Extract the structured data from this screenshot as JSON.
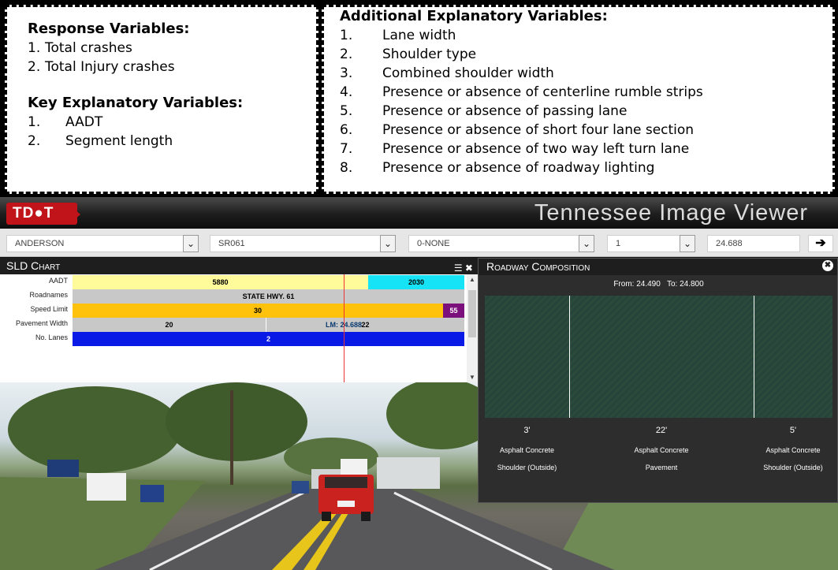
{
  "response_block": {
    "title": "Response Variables:",
    "items": [
      {
        "num": "1.",
        "text": "Total crashes"
      },
      {
        "num": "2.",
        "text": "Total Injury crashes"
      }
    ]
  },
  "key_block": {
    "title": "Key Explanatory Variables:",
    "items": [
      {
        "num": "1.",
        "text": "AADT"
      },
      {
        "num": "2.",
        "text": "Segment length"
      }
    ]
  },
  "additional_block": {
    "title": "Additional Explanatory Variables:",
    "items": [
      {
        "num": "1.",
        "text": "Lane width"
      },
      {
        "num": "2.",
        "text": "Shoulder type"
      },
      {
        "num": "3.",
        "text": "Combined shoulder width"
      },
      {
        "num": "4.",
        "text": "Presence or absence of centerline rumble strips"
      },
      {
        "num": "5.",
        "text": "Presence or absence of passing lane"
      },
      {
        "num": "6.",
        "text": "Presence or absence of short four lane section"
      },
      {
        "num": "7.",
        "text": "Presence or absence of two way left turn lane"
      },
      {
        "num": "8.",
        "text": "Presence or absence of roadway lighting"
      }
    ]
  },
  "app": {
    "logo": "TD●T",
    "title": "Tennessee Image Viewer",
    "selectors": {
      "county": "ANDERSON",
      "route": "SR061",
      "special_case": "0-NONE",
      "direction": "1",
      "log_mile": "24.688",
      "go_icon": "➔",
      "dropdown_icon": "⌄"
    },
    "sld": {
      "title": "SLD Chart",
      "row_labels": [
        "AADT",
        "Roadnames",
        "Speed Limit",
        "Pavement Width",
        "No. Lanes"
      ],
      "aadt_left": "5880",
      "aadt_right": "2030",
      "roadname": "STATE HWY. 61",
      "speed_left": "30",
      "speed_right": "55",
      "pavement_left": "20",
      "pavement_right": "22",
      "log_mile_marker": "LM: 24.688",
      "lanes": "2",
      "colors": {
        "aadt_left": "#fffa9a",
        "aadt_right": "#16e3f5",
        "roadname": "#c8c8c8",
        "speed_left": "#ffc20c",
        "speed_right": "#7b0f7b",
        "pavement": "#c8c8c8",
        "lanes": "#0a1ae6"
      }
    },
    "composition": {
      "title": "Roadway Composition",
      "from_label": "From: 24.490",
      "to_label": "To: 24.800",
      "lanes": [
        {
          "width": "3'",
          "material": "Asphalt Concrete",
          "type": "Shoulder (Outside)"
        },
        {
          "width": "22'",
          "material": "Asphalt Concrete",
          "type": "Pavement"
        },
        {
          "width": "5'",
          "material": "Asphalt Concrete",
          "type": "Shoulder (Outside)"
        }
      ]
    }
  }
}
